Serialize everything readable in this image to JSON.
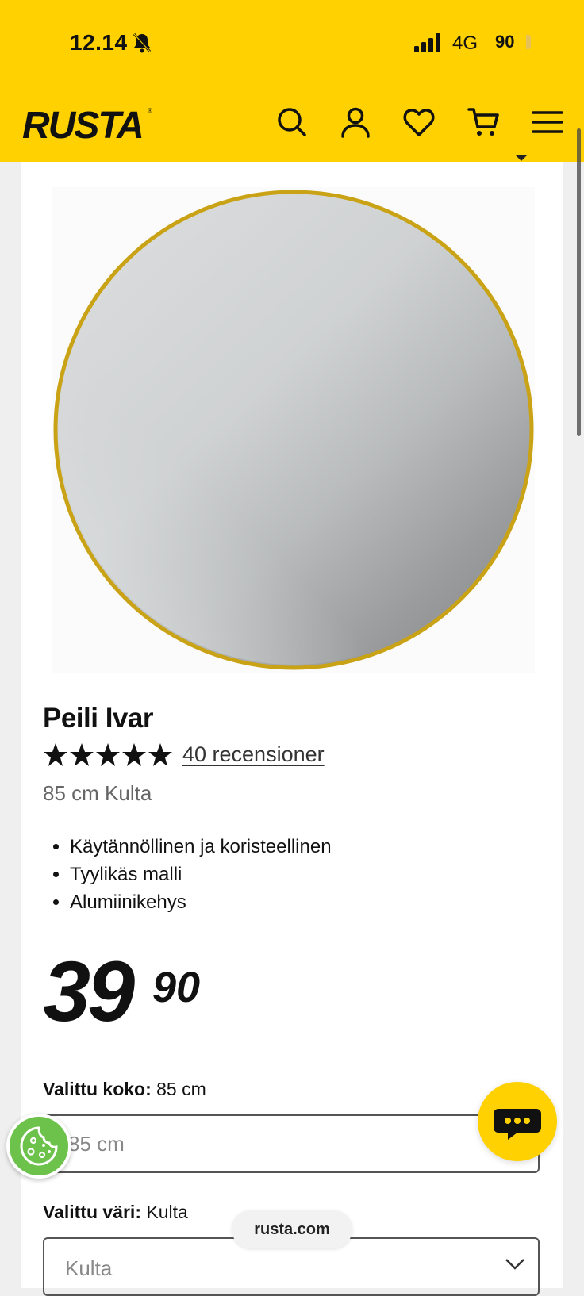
{
  "status_bar": {
    "time": "12.14",
    "network": "4G",
    "battery": "90"
  },
  "header": {
    "logo_text": "RUSTA",
    "icons": [
      "search-icon",
      "account-icon",
      "wishlist-heart-icon",
      "cart-icon",
      "menu-icon"
    ],
    "brand_color": "#ffd100"
  },
  "product": {
    "title": "Peili Ivar",
    "rating_stars": 5,
    "reviews_label": "40 recensioner",
    "variant": "85 cm Kulta",
    "features": [
      "Käytännöllinen ja koristeellinen",
      "Tyylikäs malli",
      "Alumiinikehys"
    ],
    "price_integer": "39",
    "price_decimal": "90"
  },
  "size_selector": {
    "label": "Valittu koko:",
    "selected": "85 cm",
    "field_value": "85 cm"
  },
  "color_selector": {
    "label": "Valittu väri:",
    "selected": "Kulta",
    "field_value": "Kulta"
  },
  "floating": {
    "url": "rusta.com",
    "cookie_icon": "cookie-icon",
    "chat_icon": "chat-icon",
    "cookie_color": "#6cc24a"
  }
}
